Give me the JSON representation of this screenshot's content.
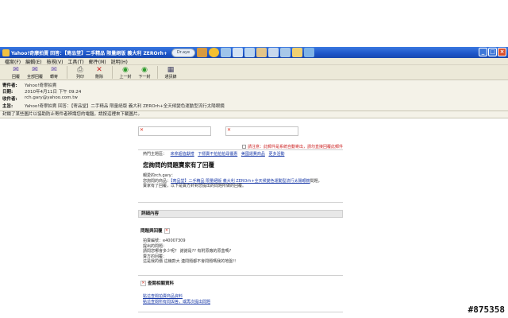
{
  "window": {
    "title": "Yahoo!奇摩拍賣 回答：【寄品堂】二手精品 限量絕版 義大利 ZEROrh+",
    "search_label": "Dr.aye",
    "minimize": "_",
    "maximize": "□",
    "close": "×"
  },
  "menu": [
    "檔案(F)",
    "編輯(E)",
    "檢視(V)",
    "工具(T)",
    "郵件(M)",
    "說明(H)"
  ],
  "toolbar": [
    {
      "label": "回覆",
      "icon": "reply-icon",
      "glyph": "✉"
    },
    {
      "label": "全部回覆",
      "icon": "reply-all-icon",
      "glyph": "✉"
    },
    {
      "label": "轉寄",
      "icon": "forward-icon",
      "glyph": "✉"
    },
    {
      "label": "列印",
      "icon": "print-icon",
      "glyph": "⎙"
    },
    {
      "label": "刪除",
      "icon": "delete-icon",
      "glyph": "✕"
    },
    {
      "label": "上一封",
      "icon": "previous-icon",
      "glyph": "◉"
    },
    {
      "label": "下一封",
      "icon": "next-icon",
      "glyph": "◉"
    },
    {
      "label": "通訊錄",
      "icon": "address-book-icon",
      "glyph": "▦"
    }
  ],
  "headers": {
    "from_label": "寄件者:",
    "from_value": "Yahoo!奇摩拍賣",
    "date_label": "日期:",
    "date_value": "2010年4月11日 下午 09:24",
    "to_label": "收件者:",
    "to_value": "rch.gary@yahoo.com.tw",
    "subject_label": "主旨:",
    "subject_value": "Yahoo!奇摩拍賣 回答：【寄品堂】二手精品 限量絕版 義大利 ZEROrh+全天候變色運動型流行太陽眼鏡"
  },
  "warning": "封鎖了某些圖片以協助防止寄件者辨識您的電腦，請按這裡來下載圖片。",
  "body": {
    "notice": "請注意：此郵件是系統自動寄出，請勿直接回覆此郵件",
    "hot_label": "熱門主題區：",
    "hot_links": [
      "來拿超值獻禮",
      "下標賣不拍拍拍尋優惠",
      "美國運費商品",
      "更多活動"
    ],
    "headline": "您詢問的問題賣家有了回覆",
    "greeting": "親愛的rch.gary：",
    "intro_prefix": "您詢問的商品：",
    "item_link": "【寄品堂】二手精品 限量絕版 義大利 ZEROrh+全天候變色運動型流行太陽眼鏡",
    "intro_suffix": "問題，",
    "intro_line2": "賣家有了回覆，以下是賣方針對您提出的問題所做的回覆。",
    "details_head": "詳細內容",
    "qa_head": "問題與回覆",
    "qa_lines": [
      "拍賣編號：e40007309",
      "提出的問題：",
      "請問您哪會多少呢？ 謝謝是?? 有附原廠的原盒嗎?",
      "賣方的回覆：",
      "這是我的價 這幾款大 連問題都不會問題嗎我的地盤!!"
    ],
    "query_head": "查閱相關資料",
    "query_links": [
      "點這查閱拍賣商品資料",
      "點這查閱所有問與答，或再次提出問題"
    ]
  },
  "watermark": "#875358"
}
